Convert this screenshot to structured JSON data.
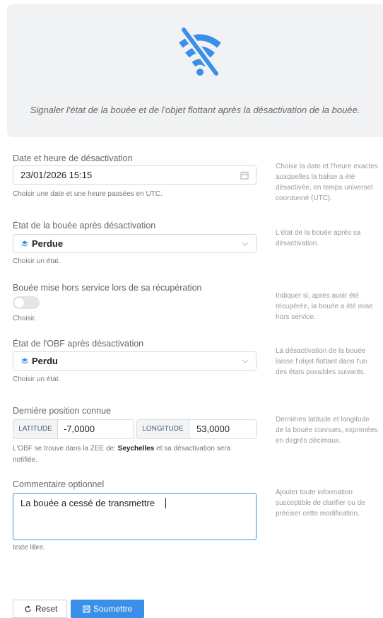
{
  "banner": {
    "icon": "wifi-off-icon",
    "color": "#3a8fe8",
    "message": "Signaler l'état de la bouée et de l'objet flottant après la désactivation de la bouée."
  },
  "deactivation_date": {
    "label": "Date et heure de désactivation",
    "value": "23/01/2026 15:15",
    "hint": "Choisir une date et une heure passées en UTC.",
    "description": "Choisir la date et l'heure exactes auxquelles la balise a été désactivée, en temps universel coordonné (UTC)."
  },
  "buoy_state": {
    "label": "État de la bouée après désactivation",
    "selected": "Perdue",
    "hint": "Choisir un état.",
    "description": "L'état de la bouée après sa désactivation."
  },
  "decommissioned": {
    "label": "Bouée mise hors service lors de sa récupération",
    "value": false,
    "hint": "Choisir.",
    "description": "Indiquer si, après avoir été récupérée, la bouée a été mise hors service."
  },
  "obf_state": {
    "label": "État de l'OBF après désactivation",
    "selected": "Perdu",
    "hint": "Choisir un état.",
    "description": "La désactivation de la bouée laisse l'objet flottant dans l'un des états possibles suivants."
  },
  "last_position": {
    "label": "Dernière position connue",
    "latitude_label": "LATITUDE",
    "latitude": "-7,0000",
    "longitude_label": "LONGITUDE",
    "longitude": "53,0000",
    "note_prefix": "L'OBF se trouve dans la ZEE de: ",
    "note_country": "Seychelles",
    "note_suffix": " et sa désactivation sera notifiée.",
    "description": "Dernières latitude et longitude de la bouée connues, exprimées en degrés décimaux."
  },
  "comment": {
    "label": "Commentaire optionnel",
    "value": "La bouée a cessé de transmettre",
    "hint": "texte libre.",
    "description": "Ajouter toute information susceptible de clarifier ou de préciser cette modification."
  },
  "actions": {
    "reset_label": "Reset",
    "submit_label": "Soumettre",
    "primary_color": "#3a8fe8"
  }
}
